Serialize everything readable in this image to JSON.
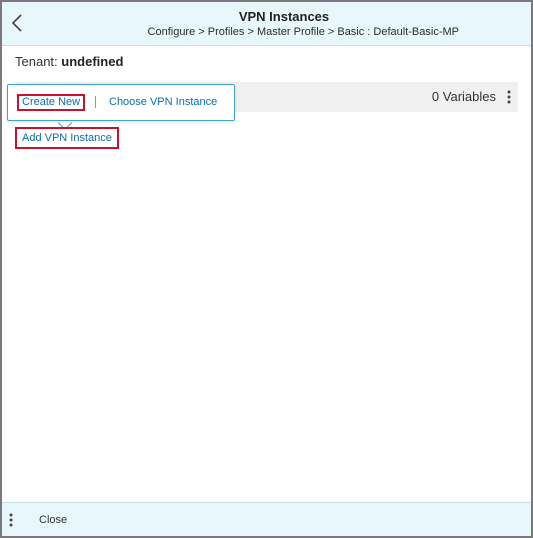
{
  "header": {
    "back_icon": "chevron-left-icon",
    "title": "VPN Instances",
    "breadcrumb": "Configure > Profiles > Master Profile > Basic : Default-Basic-MP"
  },
  "tenant": {
    "label": "Tenant:",
    "value": "undefined"
  },
  "toolbar": {
    "variables_count": "0 Variables",
    "more_icon": "kebab-vertical-icon"
  },
  "popover": {
    "create_new_label": "Create New",
    "separator": "|",
    "choose_label": "Choose VPN Instance"
  },
  "main": {
    "add_vpn_label": "Add VPN Instance"
  },
  "footer": {
    "more_icon": "kebab-vertical-icon",
    "close_label": "Close"
  },
  "colors": {
    "header_bg": "#e8f7fb",
    "link": "#0b6fa8",
    "highlight_border": "#c4122f",
    "popover_border": "#3fa6c7",
    "toolbar_bg": "#f0f0f0"
  }
}
